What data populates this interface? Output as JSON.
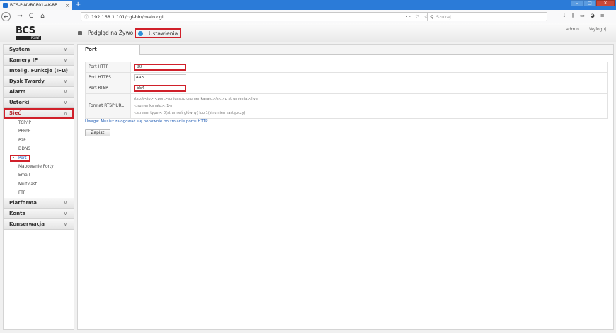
{
  "browser": {
    "tab_title": "BCS-P-NVR0801-4K-8P",
    "new_tab": "+",
    "url": "192.168.1.101/cgi-bin/main.cgi",
    "search_placeholder": "Szukaj",
    "back": "←",
    "forward": "→",
    "reload": "C",
    "home": "⌂",
    "url_icons": "··· ♡ ☆",
    "win_min": "–",
    "win_max": "□",
    "win_close": "✕",
    "tool_icons": [
      "↓",
      "⫼",
      "▭",
      "◕",
      "≡"
    ]
  },
  "header": {
    "logo_text": "BCS",
    "logo_sub": "POINT",
    "nav_live": "Podgląd na Żywo",
    "nav_settings": "Ustawienia",
    "user": "admin",
    "logout": "Wyloguj"
  },
  "sidebar": {
    "items": [
      {
        "label": "System",
        "chevron": "∨"
      },
      {
        "label": "Kamery IP",
        "chevron": "∨"
      },
      {
        "label": "Intelig. Funkcje (IFD)",
        "chevron": "∨"
      },
      {
        "label": "Dysk Twardy",
        "chevron": "∨"
      },
      {
        "label": "Alarm",
        "chevron": "∨"
      },
      {
        "label": "Usterki",
        "chevron": "∨"
      },
      {
        "label": "Sieć",
        "chevron": "∧"
      }
    ],
    "sub_items": [
      "TCP/IP",
      "PPPoE",
      "P2P",
      "DDNS",
      "Port",
      "Mapowanie Porty",
      "Email",
      "Multicast",
      "FTP"
    ],
    "bullet": "•",
    "items_after": [
      {
        "label": "Platforma",
        "chevron": "∨"
      },
      {
        "label": "Konta",
        "chevron": "∨"
      },
      {
        "label": "Konserwacja",
        "chevron": "∨"
      }
    ]
  },
  "main": {
    "tab": "Port",
    "fields": {
      "http_label": "Port HTTP",
      "http_value": "80",
      "https_label": "Port HTTPS",
      "https_value": "443",
      "rtsp_label": "Port RTSP",
      "rtsp_value": "554",
      "rtsp_url_label": "Format RTSP URL",
      "rtsp_url_lines": [
        "rtsp://<ip>:<port>/unicast/c<numer kanału>/s<typ strumienia>/live",
        "<numer kanału>: 1-n",
        "<stream type>: 0(strumień główny) lub 1(strumień zastępczy)"
      ]
    },
    "note": "Uwaga: Musisz zalogować się ponownie po zmianie portu HTTP.",
    "save": "Zapisz"
  },
  "colors": {
    "highlight": "#d0202a",
    "browser_chrome": "#2b7bd8",
    "link": "#1b63c4"
  }
}
